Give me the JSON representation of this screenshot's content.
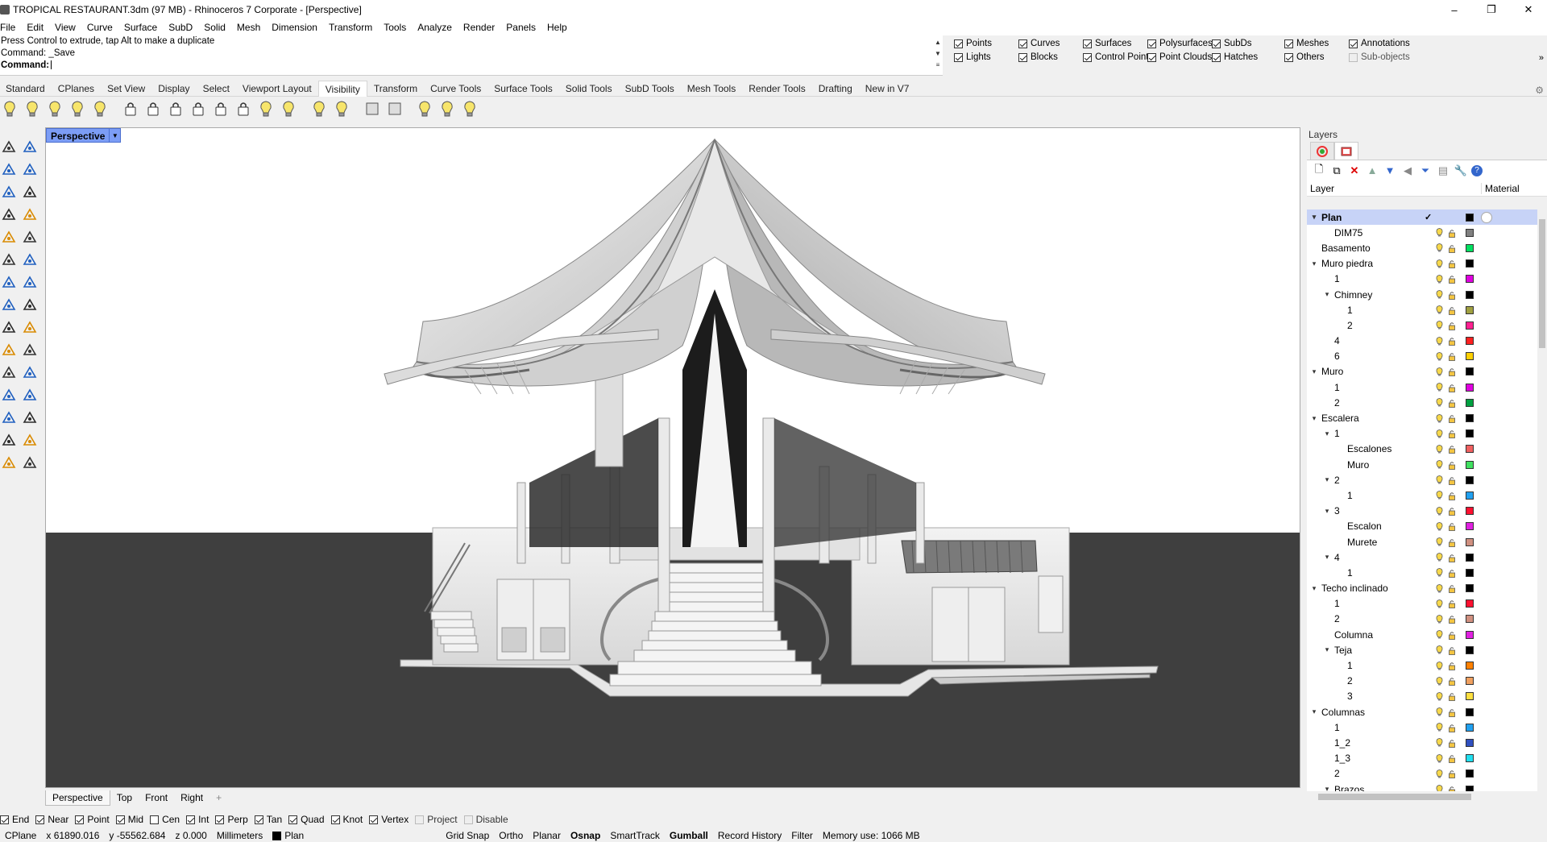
{
  "window": {
    "title": "TROPICAL RESTAURANT.3dm (97 MB) - Rhinoceros 7 Corporate - [Perspective]",
    "controls": [
      "–",
      "❐",
      "✕"
    ]
  },
  "menu": [
    "File",
    "Edit",
    "View",
    "Curve",
    "Surface",
    "SubD",
    "Solid",
    "Mesh",
    "Dimension",
    "Transform",
    "Tools",
    "Analyze",
    "Render",
    "Panels",
    "Help"
  ],
  "command": {
    "history_1": "Press Control to extrude, tap Alt to make a duplicate",
    "history_2": "Command: _Save",
    "prompt": "Command:"
  },
  "filters": [
    {
      "label": "Points",
      "checked": true
    },
    {
      "label": "Curves",
      "checked": true
    },
    {
      "label": "Surfaces",
      "checked": true
    },
    {
      "label": "Polysurfaces",
      "checked": true
    },
    {
      "label": "SubDs",
      "checked": true
    },
    {
      "label": "Meshes",
      "checked": true
    },
    {
      "label": "Annotations",
      "checked": true
    },
    {
      "label": "Lights",
      "checked": true
    },
    {
      "label": "Blocks",
      "checked": true
    },
    {
      "label": "Control Points",
      "checked": true
    },
    {
      "label": "Point Clouds",
      "checked": true
    },
    {
      "label": "Hatches",
      "checked": true
    },
    {
      "label": "Others",
      "checked": true
    },
    {
      "label": "Sub-objects",
      "checked": false
    }
  ],
  "toolbar_tabs": [
    "Standard",
    "CPlanes",
    "Set View",
    "Display",
    "Select",
    "Viewport Layout",
    "Visibility",
    "Transform",
    "Curve Tools",
    "Surface Tools",
    "Solid Tools",
    "SubD Tools",
    "Mesh Tools",
    "Render Tools",
    "Drafting",
    "New in V7"
  ],
  "active_toolbar_tab": "Visibility",
  "viewport": {
    "name": "Perspective",
    "tabs": [
      "Perspective",
      "Top",
      "Front",
      "Right"
    ],
    "add_tab": "+"
  },
  "osnaps": [
    {
      "label": "End",
      "checked": true
    },
    {
      "label": "Near",
      "checked": true
    },
    {
      "label": "Point",
      "checked": true
    },
    {
      "label": "Mid",
      "checked": true
    },
    {
      "label": "Cen",
      "checked": false
    },
    {
      "label": "Int",
      "checked": true
    },
    {
      "label": "Perp",
      "checked": true
    },
    {
      "label": "Tan",
      "checked": true
    },
    {
      "label": "Quad",
      "checked": true
    },
    {
      "label": "Knot",
      "checked": true
    },
    {
      "label": "Vertex",
      "checked": true
    },
    {
      "label": "Project",
      "checked": false,
      "disabled": true
    },
    {
      "label": "Disable",
      "checked": false,
      "disabled": true
    }
  ],
  "status": {
    "cplane": "CPlane",
    "x": "x 61890.016",
    "y": "y -55562.684",
    "z": "z 0.000",
    "units": "Millimeters",
    "layer": "Plan",
    "toggles": [
      {
        "label": "Grid Snap",
        "active": false
      },
      {
        "label": "Ortho",
        "active": false
      },
      {
        "label": "Planar",
        "active": false
      },
      {
        "label": "Osnap",
        "active": true
      },
      {
        "label": "SmartTrack",
        "active": false
      },
      {
        "label": "Gumball",
        "active": true
      },
      {
        "label": "Record History",
        "active": false
      },
      {
        "label": "Filter",
        "active": false
      }
    ],
    "memory": "Memory use: 1066 MB"
  },
  "layers": {
    "title": "Layers",
    "col_layer": "Layer",
    "col_material": "Material",
    "rows": [
      {
        "name": "Plan",
        "level": 0,
        "expand": "v",
        "color": "#000000",
        "selected": true,
        "current": true
      },
      {
        "name": "DIM75",
        "level": 1,
        "expand": "",
        "color": "#808080"
      },
      {
        "name": "Basamento",
        "level": 0,
        "expand": "",
        "color": "#00e060"
      },
      {
        "name": "Muro piedra",
        "level": 0,
        "expand": "v",
        "color": "#000000"
      },
      {
        "name": "1",
        "level": 1,
        "expand": "",
        "color": "#e000e0"
      },
      {
        "name": "Chimney",
        "level": 1,
        "expand": "v",
        "color": "#000000"
      },
      {
        "name": "1",
        "level": 2,
        "expand": "",
        "color": "#a0a040"
      },
      {
        "name": "2",
        "level": 2,
        "expand": "",
        "color": "#ff2090"
      },
      {
        "name": "4",
        "level": 1,
        "expand": "",
        "color": "#ff2020"
      },
      {
        "name": "6",
        "level": 1,
        "expand": "",
        "color": "#ffd000"
      },
      {
        "name": "Muro",
        "level": 0,
        "expand": "v",
        "color": "#000000"
      },
      {
        "name": "1",
        "level": 1,
        "expand": "",
        "color": "#e000e0"
      },
      {
        "name": "2",
        "level": 1,
        "expand": "",
        "color": "#00a040"
      },
      {
        "name": "Escalera",
        "level": 0,
        "expand": "v",
        "color": "#000000"
      },
      {
        "name": "1",
        "level": 1,
        "expand": "v",
        "color": "#000000"
      },
      {
        "name": "Escalones",
        "level": 2,
        "expand": "",
        "color": "#f06060"
      },
      {
        "name": "Muro",
        "level": 2,
        "expand": "",
        "color": "#40e060"
      },
      {
        "name": "2",
        "level": 1,
        "expand": "v",
        "color": "#000000"
      },
      {
        "name": "1",
        "level": 2,
        "expand": "",
        "color": "#20a0f0"
      },
      {
        "name": "3",
        "level": 1,
        "expand": "v",
        "color": "#ff1030"
      },
      {
        "name": "Escalon",
        "level": 2,
        "expand": "",
        "color": "#e020e0"
      },
      {
        "name": "Murete",
        "level": 2,
        "expand": "",
        "color": "#d09080"
      },
      {
        "name": "4",
        "level": 1,
        "expand": "v",
        "color": "#000000"
      },
      {
        "name": "1",
        "level": 2,
        "expand": "",
        "color": "#000000"
      },
      {
        "name": "Techo inclinado",
        "level": 0,
        "expand": "v",
        "color": "#000000"
      },
      {
        "name": "1",
        "level": 1,
        "expand": "",
        "color": "#ff1030"
      },
      {
        "name": "2",
        "level": 1,
        "expand": "",
        "color": "#d09080"
      },
      {
        "name": "Columna",
        "level": 1,
        "expand": "",
        "color": "#e020e0"
      },
      {
        "name": "Teja",
        "level": 1,
        "expand": "v",
        "color": "#000000"
      },
      {
        "name": "1",
        "level": 2,
        "expand": "",
        "color": "#ff8000"
      },
      {
        "name": "2",
        "level": 2,
        "expand": "",
        "color": "#f0a060"
      },
      {
        "name": "3",
        "level": 2,
        "expand": "",
        "color": "#ffe040"
      },
      {
        "name": "Columnas",
        "level": 0,
        "expand": "v",
        "color": "#000000"
      },
      {
        "name": "1",
        "level": 1,
        "expand": "",
        "color": "#20a0f0"
      },
      {
        "name": "1_2",
        "level": 1,
        "expand": "",
        "color": "#3050c0"
      },
      {
        "name": "1_3",
        "level": 1,
        "expand": "",
        "color": "#20e0f0"
      },
      {
        "name": "2",
        "level": 1,
        "expand": "",
        "color": "#000000"
      },
      {
        "name": "Brazos",
        "level": 1,
        "expand": "v",
        "color": "#000000"
      }
    ]
  }
}
